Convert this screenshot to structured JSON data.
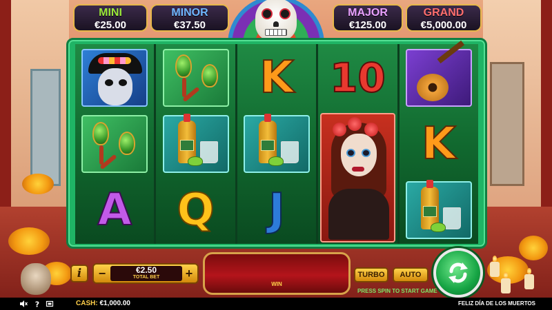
{
  "jackpots": {
    "mini": {
      "label": "MINI",
      "value": "€25.00"
    },
    "minor": {
      "label": "MINOR",
      "value": "€37.50"
    },
    "major": {
      "label": "MAJOR",
      "value": "€125.00"
    },
    "grand": {
      "label": "GRAND",
      "value": "€5,000.00"
    }
  },
  "reels": [
    [
      "wild-skull-man",
      "maracas",
      "A"
    ],
    [
      "maracas",
      "tequila",
      "Q"
    ],
    [
      "K",
      "tequila",
      "J"
    ],
    [
      "10",
      "catrina",
      "catrina"
    ],
    [
      "guitar",
      "K",
      "tequila"
    ]
  ],
  "symbols": {
    "K": "K",
    "ten": "10",
    "A": "A",
    "Q": "Q",
    "J": "J"
  },
  "controls": {
    "info_label": "i",
    "bet_minus": "−",
    "bet_plus": "+",
    "bet_value": "€2.50",
    "bet_caption": "TOTAL BET",
    "win_label": "WIN",
    "turbo_label": "TURBO",
    "auto_label": "AUTO",
    "spin_hint": "PRESS SPIN TO START GAME"
  },
  "statusbar": {
    "cash_label": "CASH:",
    "cash_value": "€1,000.00",
    "game_title": "FELIZ DÍA DE LOS MUERTOS"
  },
  "colors": {
    "frame_green": "#1fb465",
    "accent_gold": "#ffd24a",
    "spin_green": "#16a444",
    "win_red": "#b4141b"
  }
}
